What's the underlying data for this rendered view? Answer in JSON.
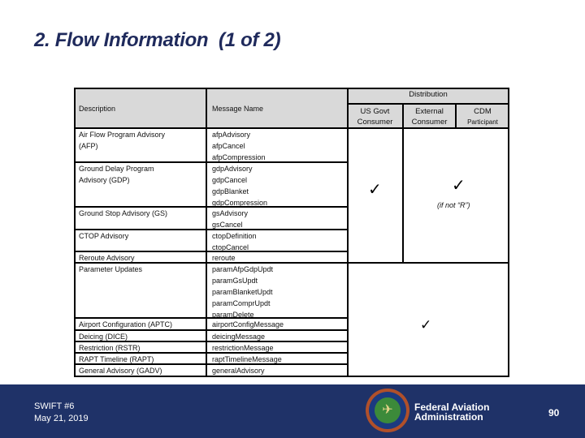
{
  "title": "2. Flow Information  (1 of 2)",
  "table": {
    "headers": {
      "description": "Description",
      "message_name": "Message Name",
      "distribution": "Distribution",
      "us_govt": [
        "US Govt",
        "Consumer"
      ],
      "external": [
        "External",
        "Consumer"
      ],
      "cdm": [
        "CDM",
        "Participant"
      ]
    },
    "rows": [
      {
        "description": [
          "Air Flow Program Advisory",
          "(AFP)"
        ],
        "messages": [
          "afpAdvisory",
          "afpCancel",
          "afpCompression"
        ]
      },
      {
        "description": [
          "Ground Delay Program",
          "Advisory (GDP)"
        ],
        "messages": [
          "gdpAdvisory",
          "gdpCancel",
          "gdpBlanket",
          "gdpCompression"
        ]
      },
      {
        "description": [
          "Ground Stop Advisory (GS)"
        ],
        "messages": [
          "gsAdvisory",
          "gsCancel"
        ]
      },
      {
        "description": [
          "CTOP Advisory"
        ],
        "messages": [
          "ctopDefinition",
          "ctopCancel"
        ]
      },
      {
        "description": [
          "Reroute Advisory"
        ],
        "messages": [
          "reroute"
        ]
      },
      {
        "description": [
          "Parameter Updates"
        ],
        "messages": [
          "paramAfpGdpUpdt",
          "paramGsUpdt",
          "paramBlanketUpdt",
          "paramComprUpdt",
          "paramDelete"
        ]
      },
      {
        "description": [
          "Airport Configuration (APTC)"
        ],
        "messages": [
          "airportConfigMessage"
        ]
      },
      {
        "description": [
          "Deicing (DICE)"
        ],
        "messages": [
          "deicingMessage"
        ]
      },
      {
        "description": [
          "Restriction (RSTR)"
        ],
        "messages": [
          "restrictionMessage"
        ]
      },
      {
        "description": [
          "RAPT Timeline (RAPT)"
        ],
        "messages": [
          "raptTimelineMessage"
        ]
      },
      {
        "description": [
          "General Advisory (GADV)"
        ],
        "messages": [
          "generalAdvisory"
        ]
      }
    ],
    "distribution_marks": {
      "upper_us_govt": "✓",
      "upper_external_cdm": "✓",
      "upper_external_cdm_note": "(if not “R”)",
      "lower_all": "✓"
    }
  },
  "footer": {
    "event": "SWIFT #6",
    "date": "May 21, 2019",
    "org_line1": "Federal Aviation",
    "org_line2": "Administration",
    "page_number": "90",
    "logo": "faa-seal-icon"
  }
}
